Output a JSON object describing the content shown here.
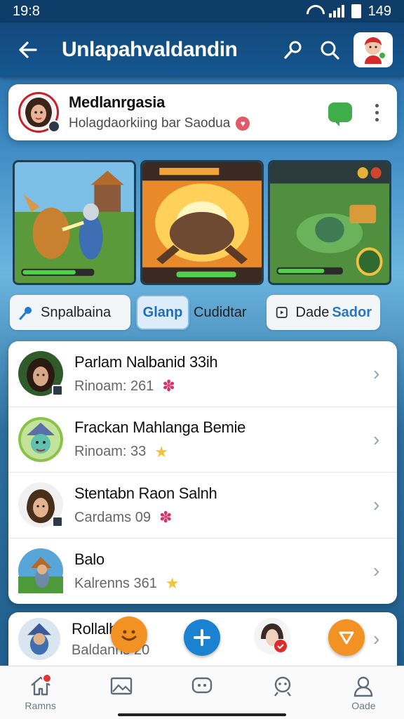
{
  "status_bar": {
    "time": "19:8",
    "battery": "149"
  },
  "app_bar": {
    "title": "Unlapahvaldandin"
  },
  "header": {
    "name": "Medlanrgasia",
    "subtitle": "Holagdaorkiing bar Saodua"
  },
  "chips": [
    {
      "label": "Snpalbaina"
    },
    {
      "label": "Glanp"
    },
    {
      "label": "Cudidtar"
    },
    {
      "label": "Dade"
    },
    {
      "label": "Sador"
    }
  ],
  "list": [
    {
      "title": "Parlam Nalbanid 33ih",
      "sub": "Rinoam: 261",
      "star": "✽",
      "star_color": "#d6336c"
    },
    {
      "title": "Frackan Mahlanga Bemie",
      "sub": "Rinoam: 33",
      "star": "★",
      "star_color": "#f2c33a"
    },
    {
      "title": "Stentabn Raon Salnh",
      "sub": "Cardams 09",
      "star": "✽",
      "star_color": "#d6336c"
    },
    {
      "title": "Balo",
      "sub": "Kalrenns 361",
      "star": "★",
      "star_color": "#f2c33a"
    }
  ],
  "partial": {
    "title": "Rollalb",
    "sub": "Baldanns 20"
  },
  "nav": [
    {
      "label": "Ramns",
      "icon": "home-icon"
    },
    {
      "label": "",
      "icon": "image-icon"
    },
    {
      "label": "",
      "icon": "chat-icon"
    },
    {
      "label": "",
      "icon": "face-icon"
    },
    {
      "label": "Oade",
      "icon": "person-icon"
    }
  ],
  "colors": {
    "primary": "#155690",
    "accent_orange": "#f29222",
    "accent_blue": "#1a82d0"
  }
}
